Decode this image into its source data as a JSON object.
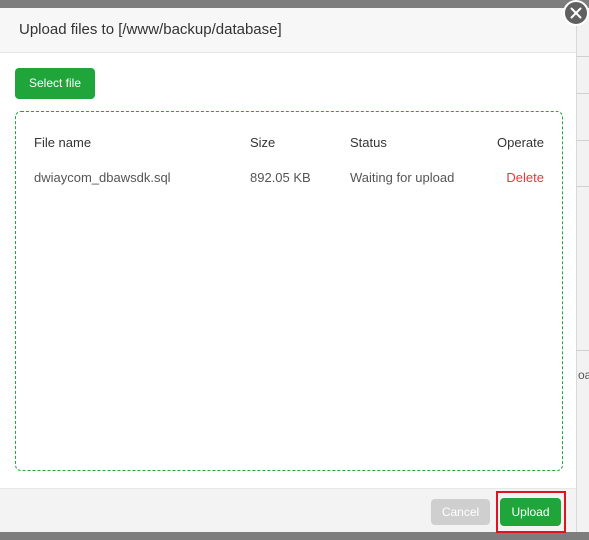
{
  "dialog": {
    "title": "Upload files to [/www/backup/database]",
    "select_file_label": "Select file",
    "close_icon": "close-icon"
  },
  "table": {
    "headers": {
      "name": "File name",
      "size": "Size",
      "status": "Status",
      "operate": "Operate"
    },
    "rows": [
      {
        "name": "dwiaycom_dbawsdk.sql",
        "size": "892.05 KB",
        "status": "Waiting for upload",
        "operate": "Delete"
      }
    ]
  },
  "footer": {
    "cancel_label": "Cancel",
    "upload_label": "Upload"
  },
  "background": {
    "partial_text": "oa"
  },
  "colors": {
    "accent": "#20a53a",
    "danger": "#e4393c",
    "highlight": "#e0131e",
    "disabled": "#cfcfcf"
  }
}
